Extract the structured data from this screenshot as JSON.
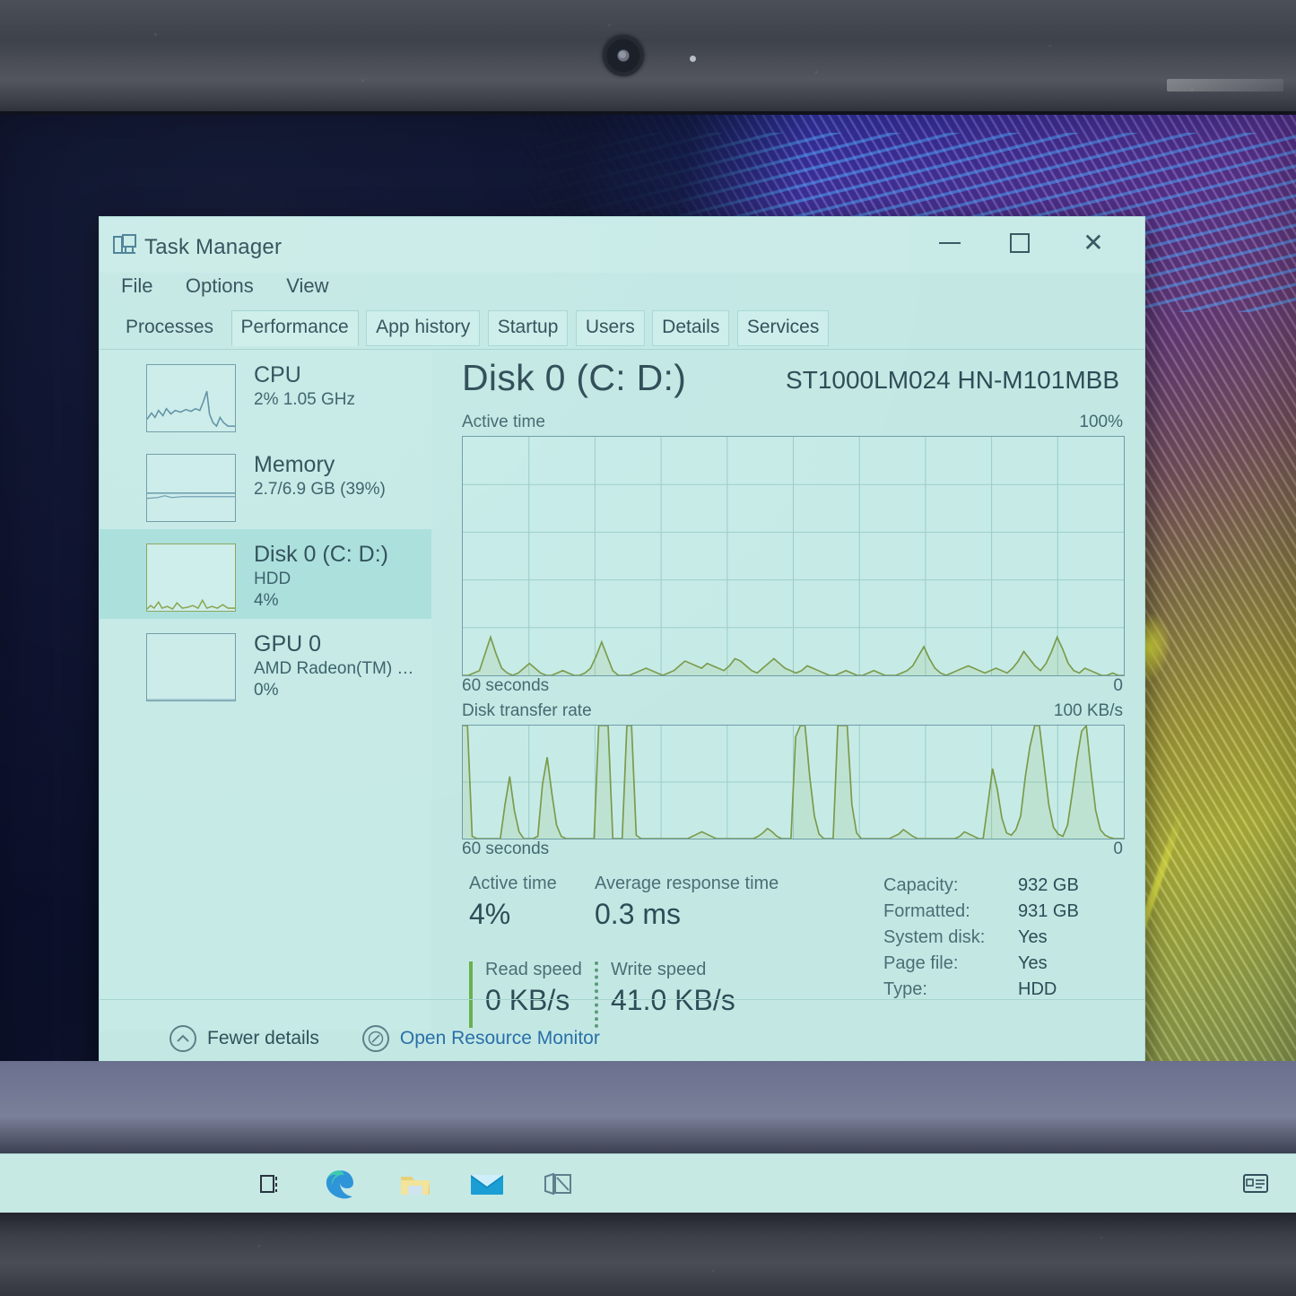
{
  "window": {
    "title": "Task Manager",
    "app_icon": "task-manager-icon",
    "controls": {
      "minimize": "–",
      "maximize": "□",
      "close": "✕"
    }
  },
  "menu": {
    "items": [
      "File",
      "Options",
      "View"
    ]
  },
  "tabs": [
    {
      "label": "Processes",
      "state": "normal"
    },
    {
      "label": "Performance",
      "state": "selected"
    },
    {
      "label": "App history",
      "state": "hovered"
    },
    {
      "label": "Startup",
      "state": "hovered"
    },
    {
      "label": "Users",
      "state": "hovered"
    },
    {
      "label": "Details",
      "state": "hovered"
    },
    {
      "label": "Services",
      "state": "hovered"
    }
  ],
  "sidebar": {
    "items": [
      {
        "title": "CPU",
        "sub1": "2%  1.05 GHz",
        "sub2": "",
        "selected": false
      },
      {
        "title": "Memory",
        "sub1": "2.7/6.9 GB (39%)",
        "sub2": "",
        "selected": false
      },
      {
        "title": "Disk 0 (C: D:)",
        "sub1": "HDD",
        "sub2": "4%",
        "selected": true
      },
      {
        "title": "GPU 0",
        "sub1": "AMD Radeon(TM) …",
        "sub2": "0%",
        "selected": false
      }
    ]
  },
  "main": {
    "title": "Disk 0 (C: D:)",
    "model": "ST1000LM024 HN-M101MBB",
    "active_graph": {
      "caption": "Active time",
      "max_label": "100%",
      "x_left": "60 seconds",
      "x_right": "0"
    },
    "rate_graph": {
      "caption": "Disk transfer rate",
      "max_label": "100 KB/s",
      "x_left": "60 seconds",
      "x_right": "0"
    },
    "stats": {
      "active_time_label": "Active time",
      "active_time_value": "4%",
      "avg_response_label": "Average response time",
      "avg_response_value": "0.3 ms",
      "read_speed_label": "Read speed",
      "read_speed_value": "0 KB/s",
      "write_speed_label": "Write speed",
      "write_speed_value": "41.0 KB/s"
    },
    "info": [
      {
        "key": "Capacity:",
        "value": "932 GB"
      },
      {
        "key": "Formatted:",
        "value": "931 GB"
      },
      {
        "key": "System disk:",
        "value": "Yes"
      },
      {
        "key": "Page file:",
        "value": "Yes"
      },
      {
        "key": "Type:",
        "value": "HDD"
      }
    ]
  },
  "footer": {
    "fewer_details": "Fewer details",
    "fewer_details_icon": "chevron-up-circle-icon",
    "resource_monitor": "Open Resource Monitor",
    "resource_monitor_icon": "gauge-icon"
  },
  "taskbar": {
    "icons": [
      {
        "name": "task-view-icon"
      },
      {
        "name": "edge-browser-icon"
      },
      {
        "name": "file-explorer-icon"
      },
      {
        "name": "mail-icon"
      },
      {
        "name": "store-icon"
      },
      {
        "name": "action-center-icon"
      }
    ]
  },
  "colors": {
    "window_bg": "#c3e8e4",
    "selected_row": "#aadfdc",
    "graph_line": "#7a9a4a",
    "text": "#2d4c56",
    "link": "#2a6fa8",
    "accent_green": "#6ab04c"
  },
  "chart_data": [
    {
      "type": "area",
      "title": "Active time",
      "ylabel": "Active time",
      "xlabel": "60 seconds",
      "ylim": [
        0,
        100
      ],
      "ytick_labels": [
        "100%",
        "0"
      ],
      "xtick_labels": [
        "60 seconds",
        "0"
      ],
      "grid": true,
      "series": [
        {
          "name": "Active time %",
          "values": [
            0,
            0,
            1,
            2,
            9,
            16,
            9,
            3,
            1,
            0,
            1,
            3,
            5,
            3,
            1,
            0,
            0,
            1,
            2,
            1,
            0,
            0,
            1,
            3,
            8,
            14,
            8,
            2,
            0,
            0,
            0,
            1,
            2,
            3,
            2,
            1,
            0,
            1,
            2,
            4,
            6,
            5,
            4,
            3,
            5,
            4,
            3,
            2,
            4,
            7,
            6,
            4,
            2,
            1,
            3,
            5,
            7,
            5,
            3,
            2,
            1,
            2,
            4,
            3,
            2,
            1,
            0,
            0,
            1,
            2,
            1,
            0,
            0,
            1,
            2,
            1,
            0,
            0,
            0,
            1,
            2,
            4,
            8,
            12,
            7,
            3,
            1,
            0,
            1,
            2,
            3,
            4,
            3,
            2,
            1,
            2,
            3,
            2,
            1,
            3,
            6,
            10,
            7,
            4,
            2,
            5,
            10,
            16,
            11,
            5,
            2,
            1,
            3,
            2,
            1,
            0,
            0,
            1,
            0,
            0
          ]
        }
      ]
    },
    {
      "type": "area",
      "title": "Disk transfer rate",
      "ylabel": "Disk transfer rate",
      "xlabel": "60 seconds",
      "ylim": [
        0,
        100
      ],
      "yunit": "KB/s",
      "ytick_labels": [
        "100 KB/s",
        "0"
      ],
      "xtick_labels": [
        "60 seconds",
        "0"
      ],
      "grid": true,
      "series": [
        {
          "name": "Transfer rate KB/s",
          "values": [
            100,
            100,
            2,
            0,
            0,
            0,
            0,
            0,
            0,
            30,
            55,
            25,
            6,
            0,
            0,
            0,
            2,
            48,
            72,
            40,
            12,
            2,
            0,
            0,
            0,
            0,
            0,
            0,
            0,
            100,
            100,
            100,
            0,
            0,
            0,
            100,
            100,
            3,
            0,
            0,
            0,
            0,
            0,
            0,
            0,
            0,
            0,
            0,
            0,
            2,
            4,
            6,
            4,
            2,
            0,
            0,
            0,
            0,
            0,
            0,
            0,
            0,
            0,
            2,
            5,
            9,
            6,
            2,
            0,
            0,
            0,
            90,
            100,
            100,
            55,
            20,
            4,
            0,
            0,
            0,
            100,
            100,
            100,
            30,
            5,
            0,
            0,
            0,
            0,
            0,
            0,
            0,
            2,
            4,
            8,
            5,
            2,
            0,
            0,
            0,
            0,
            0,
            0,
            0,
            0,
            0,
            2,
            6,
            4,
            2,
            0,
            0,
            30,
            62,
            44,
            18,
            5,
            3,
            8,
            20,
            55,
            82,
            100,
            100,
            65,
            30,
            10,
            4,
            2,
            12,
            40,
            70,
            95,
            100,
            60,
            25,
            8,
            3,
            1,
            0,
            0,
            0
          ]
        }
      ]
    }
  ]
}
